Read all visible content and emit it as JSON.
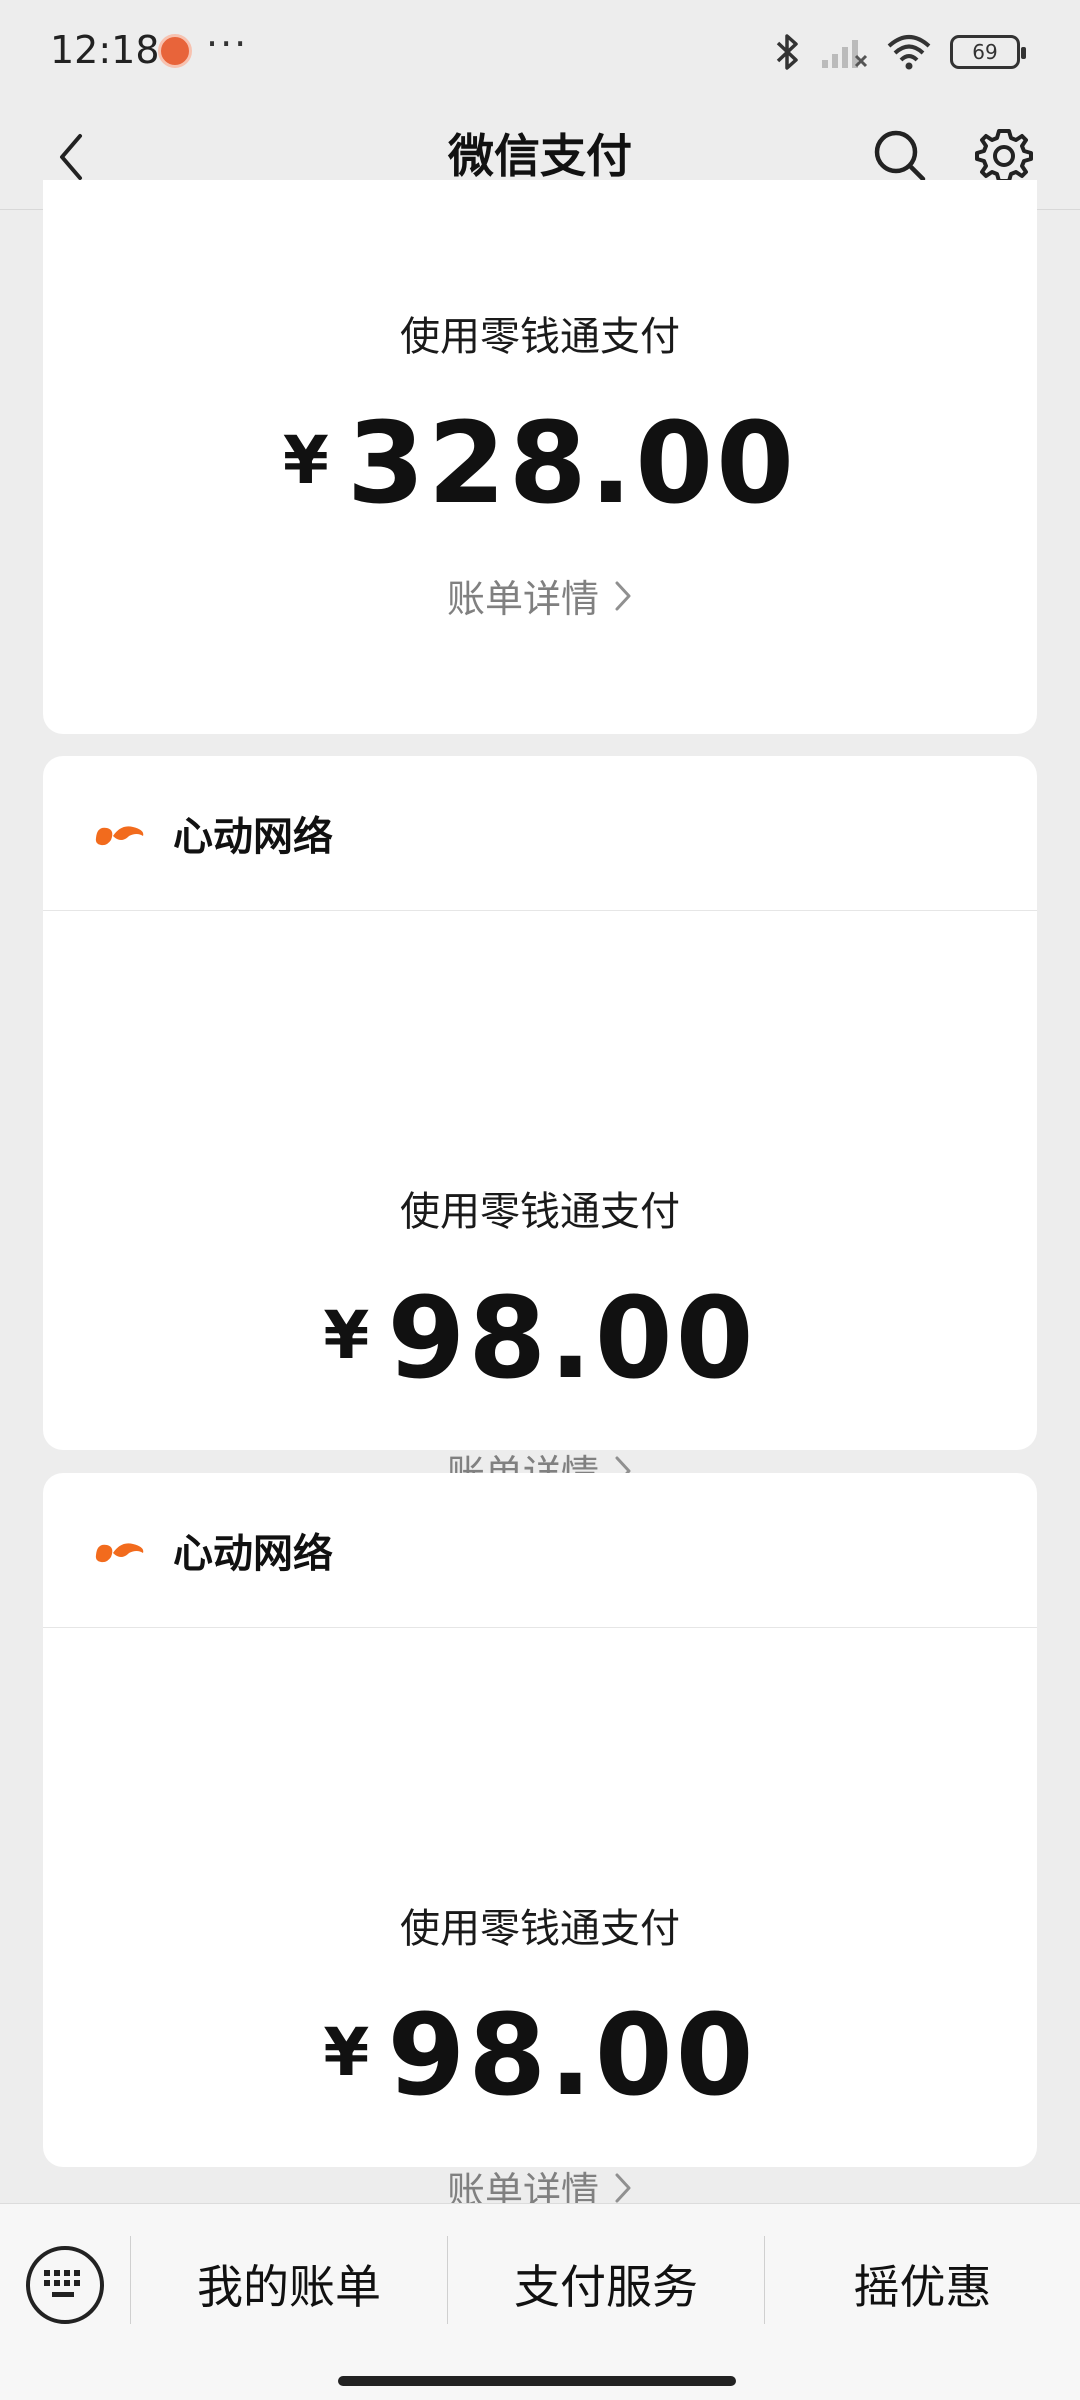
{
  "status_bar": {
    "time": "12:18",
    "dots": "···",
    "battery_level": "69",
    "icons": [
      "app-notification-icon",
      "bluetooth-icon",
      "cellular-signal-icon",
      "wifi-icon",
      "battery-icon"
    ]
  },
  "nav": {
    "title": "微信支付",
    "icons": [
      "back-icon",
      "search-icon",
      "gear-icon"
    ]
  },
  "cards": [
    {
      "merchant": "",
      "pay_method": "使用零钱通支付",
      "currency": "¥",
      "amount": "328.00",
      "detail_label": "账单详情"
    },
    {
      "merchant": "心动网络",
      "pay_method": "使用零钱通支付",
      "currency": "¥",
      "amount": "98.00",
      "detail_label": "账单详情"
    },
    {
      "merchant": "心动网络",
      "pay_method": "使用零钱通支付",
      "currency": "¥",
      "amount": "98.00",
      "detail_label": "账单详情"
    }
  ],
  "bottom_menu": {
    "items": [
      "我的账单",
      "支付服务",
      "摇优惠"
    ],
    "keyboard_icon": "keyboard-icon"
  },
  "colors": {
    "background": "#ededed",
    "card": "#ffffff",
    "brand_orange": "#f26b1d",
    "link_gray": "#808080"
  }
}
